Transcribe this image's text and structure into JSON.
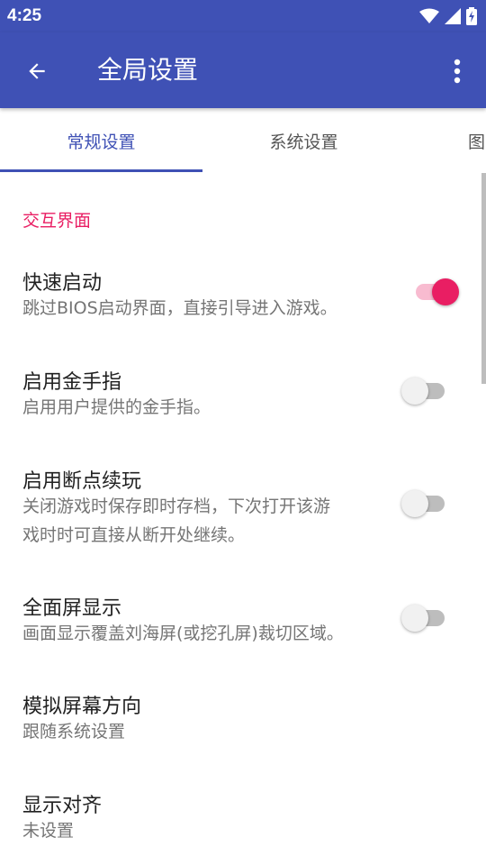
{
  "status_bar": {
    "time": "4:25"
  },
  "app_bar": {
    "title": "全局设置"
  },
  "tabs": [
    {
      "label": "常规设置",
      "active": true
    },
    {
      "label": "系统设置",
      "active": false
    },
    {
      "label": "图",
      "active": false
    }
  ],
  "section": {
    "header": "交互界面"
  },
  "preferences": [
    {
      "title": "快速启动",
      "summary": "跳过BIOS启动界面，直接引导进入游戏。",
      "switch": true,
      "checked": true
    },
    {
      "title": "启用金手指",
      "summary": "启用用户提供的金手指。",
      "switch": true,
      "checked": false
    },
    {
      "title": "启用断点续玩",
      "summary_line1": "关闭游戏时保存即时存档，下次打开该游",
      "summary_line2": "戏时时可直接从断开处继续。",
      "switch": true,
      "checked": false
    },
    {
      "title": "全面屏显示",
      "summary": "画面显示覆盖刘海屏(或挖孔屏)裁切区域。",
      "switch": true,
      "checked": false
    },
    {
      "title": "模拟屏幕方向",
      "summary": "跟随系统设置",
      "switch": false
    },
    {
      "title": "显示对齐",
      "summary": "未设置",
      "switch": false
    }
  ],
  "colors": {
    "primary": "#3F51B5",
    "accent": "#E91E63"
  },
  "icons": [
    "wifi-icon",
    "signal-icon",
    "battery-charging-icon",
    "back-arrow-icon",
    "more-vert-icon"
  ]
}
